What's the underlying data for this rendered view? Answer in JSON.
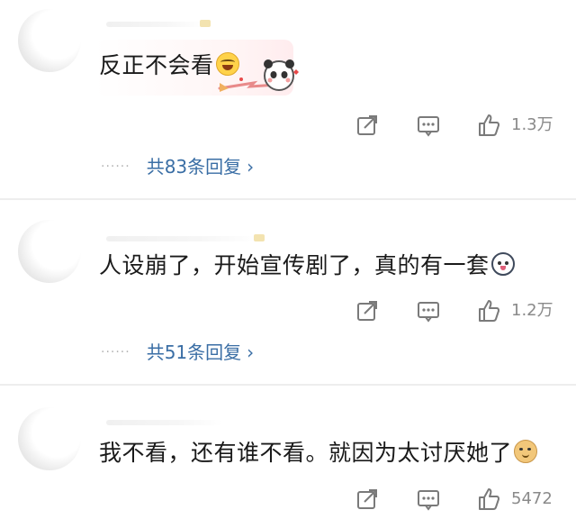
{
  "comments": [
    {
      "text": "反正不会看",
      "emoji": "laughing-tears-emoji",
      "sticker": "panda-sticker",
      "likes": "1.3万",
      "replies": {
        "dots": "······",
        "label": "共83条回复"
      }
    },
    {
      "text": "人设崩了，开始宣传剧了，真的有一套",
      "emoji": "husky-emoji",
      "likes": "1.2万",
      "replies": {
        "dots": "······",
        "label": "共51条回复"
      }
    },
    {
      "text": "我不看，还有谁不看。就因为太讨厌她了",
      "emoji": "doge-emoji",
      "likes": "5472"
    }
  ],
  "icons": {
    "share": "share-icon",
    "comment": "comment-icon",
    "like": "like-icon",
    "chevron": "chevron-right-icon"
  },
  "colors": {
    "link": "#3a6ea5",
    "muted": "#8a8a8a",
    "icon": "#7a7a7a"
  }
}
